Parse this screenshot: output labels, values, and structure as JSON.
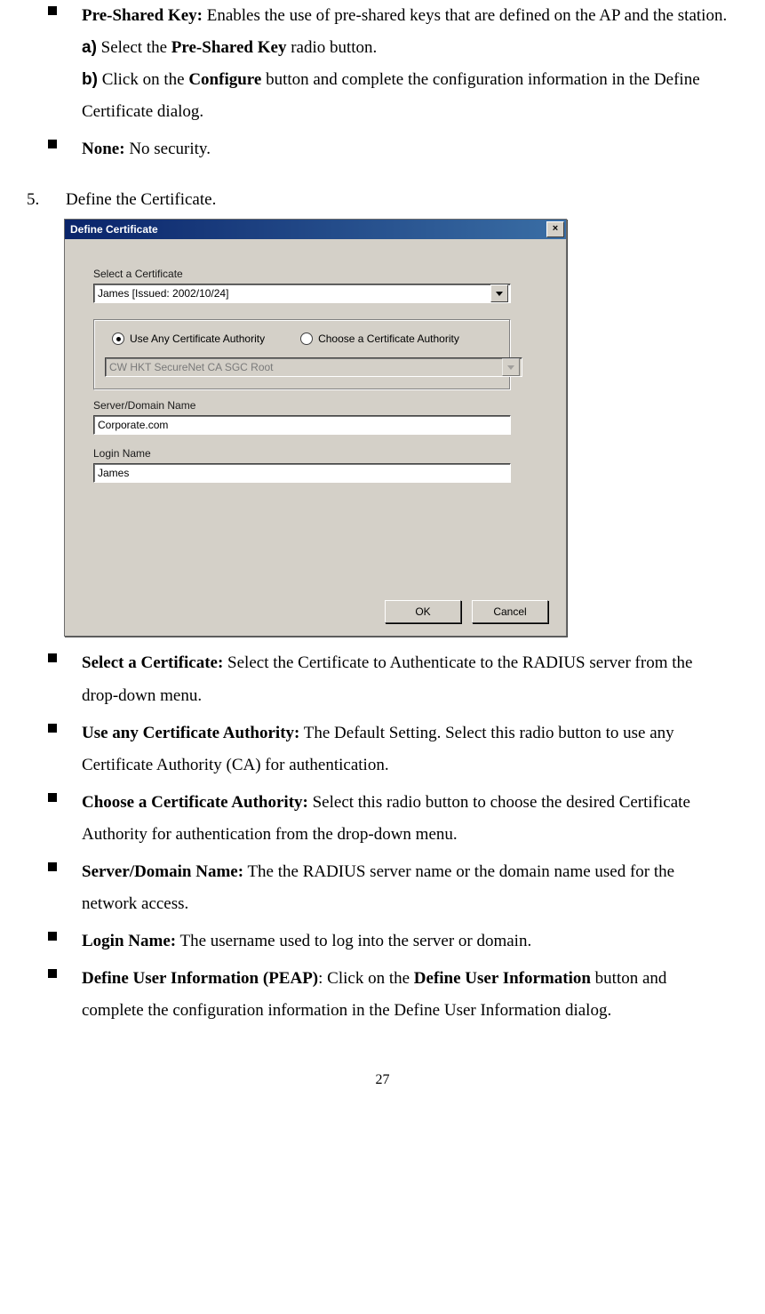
{
  "top_bullets": [
    {
      "term": "Pre-Shared Key:",
      "text": " Enables the use of pre-shared keys that are defined on the AP and the station.",
      "substeps": [
        {
          "label": "a)",
          "preText": " Select the ",
          "bold": "Pre-Shared Key",
          "postText": " radio button."
        },
        {
          "label": "b)",
          "preText": " Click on the ",
          "bold": "Configure",
          "postText": " button and complete the configuration information in the Define Certificate dialog."
        }
      ]
    },
    {
      "term": "None:",
      "text": " No security."
    }
  ],
  "step": {
    "num": "5.",
    "text": "Define the Certificate."
  },
  "dialog": {
    "title": "Define Certificate",
    "selectCertLabel": "Select a Certificate",
    "selectCertValue": "James   [Issued: 2002/10/24]",
    "radioUseAny": "Use Any Certificate Authority",
    "radioChoose": "Choose a Certificate Authority",
    "caComboValue": "CW HKT SecureNet CA SGC Root",
    "serverLabel": "Server/Domain Name",
    "serverValue": "Corporate.com",
    "loginLabel": "Login Name",
    "loginValue": "James",
    "okBtn": "OK",
    "cancelBtn": "Cancel"
  },
  "bottom_bullets": [
    {
      "term": "Select a Certificate:",
      "text": " Select the Certificate to Authenticate to the RADIUS server from the drop-down menu."
    },
    {
      "term": "Use any Certificate Authority:",
      "text": " The Default Setting. Select this radio button to use any Certificate Authority (CA) for authentication."
    },
    {
      "term": "Choose a Certificate Authority:",
      "text": " Select this radio button to choose the desired Certificate Authority for authentication from the drop-down menu."
    },
    {
      "term": "Server/Domain Name:",
      "text": " The the RADIUS server name or the domain name used for the network access."
    },
    {
      "term": "Login Name:",
      "text": " The username used to log into the server or domain."
    },
    {
      "term": "Define User Information (PEAP)",
      "text_pre": ": Click on the ",
      "bold_inline": "Define User Information",
      "text_post": " button and complete the configuration information in the Define User Information dialog."
    }
  ],
  "pageNumber": "27"
}
